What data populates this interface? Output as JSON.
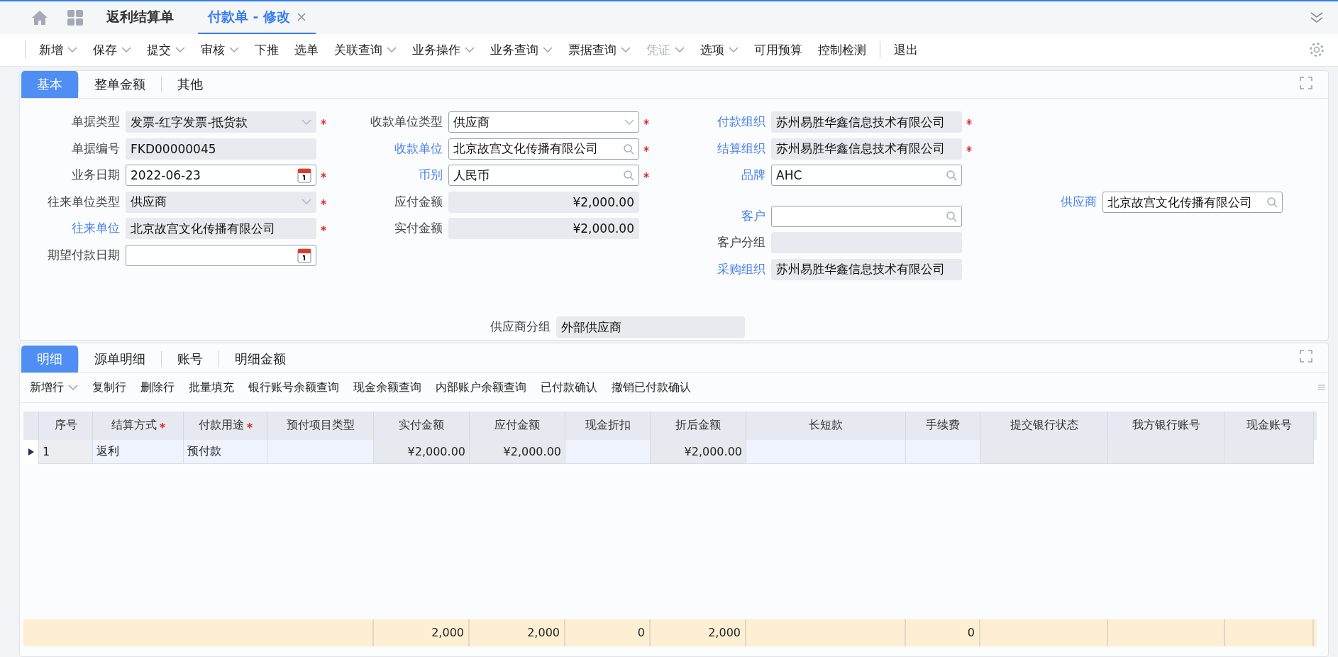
{
  "top_tabs": [
    {
      "label": "返利结算单",
      "selected": false,
      "closable": false
    },
    {
      "label": "付款单 - 修改",
      "selected": true,
      "closable": true
    }
  ],
  "toolbar": {
    "groups": [
      [
        {
          "label": "新增",
          "dropdown": true,
          "disabled": false
        },
        {
          "label": "保存",
          "dropdown": true,
          "disabled": false
        },
        {
          "label": "提交",
          "dropdown": true,
          "disabled": false
        },
        {
          "label": "审核",
          "dropdown": true,
          "disabled": false
        },
        {
          "label": "下推",
          "dropdown": false,
          "disabled": false
        },
        {
          "label": "选单",
          "dropdown": false,
          "disabled": false
        },
        {
          "label": "关联查询",
          "dropdown": true,
          "disabled": false
        },
        {
          "label": "业务操作",
          "dropdown": true,
          "disabled": false
        },
        {
          "label": "业务查询",
          "dropdown": true,
          "disabled": false
        },
        {
          "label": "票据查询",
          "dropdown": true,
          "disabled": false
        },
        {
          "label": "凭证",
          "dropdown": true,
          "disabled": true
        },
        {
          "label": "选项",
          "dropdown": true,
          "disabled": false
        },
        {
          "label": "可用预算",
          "dropdown": false,
          "disabled": false
        },
        {
          "label": "控制检测",
          "dropdown": false,
          "disabled": false
        }
      ],
      [
        {
          "label": "退出",
          "dropdown": false,
          "disabled": false
        }
      ]
    ]
  },
  "header_tabs": [
    {
      "label": "基本",
      "selected": true
    },
    {
      "label": "整单金额",
      "selected": false
    },
    {
      "label": "其他",
      "selected": false
    }
  ],
  "form": {
    "columns": [
      [
        {
          "label": "单据类型",
          "kind": "select",
          "value": "发票-红字发票-抵货款",
          "readonly": true,
          "link": false,
          "required": true
        },
        {
          "label": "单据编号",
          "value": "FKD00000045",
          "readonly": true,
          "link": false,
          "required": false
        },
        {
          "label": "业务日期",
          "kind": "date",
          "value": "2022-06-23",
          "readonly": false,
          "link": false,
          "required": true
        },
        {
          "label": "往来单位类型",
          "kind": "select",
          "value": "供应商",
          "readonly": true,
          "link": false,
          "required": true
        },
        {
          "label": "往来单位",
          "value": "北京故宫文化传播有限公司",
          "readonly": true,
          "link": true,
          "required": true
        },
        {
          "label": "期望付款日期",
          "kind": "date",
          "readonly": false,
          "link": false,
          "required": false
        }
      ],
      [
        {
          "label": "收款单位类型",
          "kind": "select",
          "value": "供应商",
          "readonly": false,
          "link": false,
          "required": true
        },
        {
          "label": "收款单位",
          "kind": "lookup",
          "value": "北京故宫文化传播有限公司",
          "readonly": false,
          "link": true,
          "required": true
        },
        {
          "label": "币别",
          "kind": "lookup",
          "value": "人民币",
          "readonly": false,
          "link": true,
          "required": true
        },
        {
          "label": "应付金额",
          "kind": "amount",
          "value": "¥2,000.00",
          "readonly": true,
          "link": false,
          "required": false
        },
        {
          "label": "实付金额",
          "kind": "amount",
          "value": "¥2,000.00",
          "readonly": true,
          "link": false,
          "required": false
        }
      ],
      [
        {
          "label": "付款组织",
          "value": "苏州易胜华鑫信息技术有限公司",
          "readonly": true,
          "link": true,
          "required": true
        },
        {
          "label": "结算组织",
          "value": "苏州易胜华鑫信息技术有限公司",
          "readonly": true,
          "link": true,
          "required": true
        },
        {
          "label": "品牌",
          "kind": "lookup",
          "value": "AHC",
          "readonly": false,
          "link": true,
          "required": false
        },
        {
          "label": "客户",
          "kind": "lookup",
          "readonly": false,
          "link": true,
          "required": false
        },
        {
          "label": "客户分组",
          "readonly": true,
          "link": false,
          "required": false
        },
        {
          "label": "采购组织",
          "value": "苏州易胜华鑫信息技术有限公司",
          "readonly": true,
          "link": true,
          "required": false
        }
      ],
      [
        {
          "label": "供应商",
          "kind": "lookup",
          "value": "北京故宫文化传播有限公司",
          "readonly": false,
          "link": true,
          "required": false
        }
      ]
    ],
    "bottom": {
      "label": "供应商分组",
      "value": "外部供应商",
      "readonly": true,
      "link": false,
      "required": false
    }
  },
  "detail_tabs": [
    {
      "label": "明细",
      "selected": true
    },
    {
      "label": "源单明细",
      "selected": false
    },
    {
      "label": "账号",
      "selected": false
    },
    {
      "label": "明细金额",
      "selected": false
    }
  ],
  "detail_toolbar": [
    {
      "label": "新增行",
      "dropdown": true
    },
    {
      "label": "复制行",
      "dropdown": false
    },
    {
      "label": "删除行",
      "dropdown": false
    },
    {
      "label": "批量填充",
      "dropdown": false
    },
    {
      "label": "银行账号余额查询",
      "dropdown": false
    },
    {
      "label": "现金余额查询",
      "dropdown": false
    },
    {
      "label": "内部账户余额查询",
      "dropdown": false
    },
    {
      "label": "已付款确认",
      "dropdown": false
    },
    {
      "label": "撤销已付款确认",
      "dropdown": false
    }
  ],
  "table": {
    "columns": [
      {
        "label": "序号",
        "kind": "index",
        "required": false
      },
      {
        "label": "结算方式",
        "editable": true,
        "required": true
      },
      {
        "label": "付款用途",
        "editable": true,
        "required": true
      },
      {
        "label": "预付项目类型",
        "editable": true,
        "required": false
      },
      {
        "label": "实付金额",
        "kind": "amount",
        "editable": false,
        "required": false,
        "total": "2,000"
      },
      {
        "label": "应付金额",
        "kind": "amount",
        "editable": false,
        "required": false,
        "total": "2,000"
      },
      {
        "label": "现金折扣",
        "kind": "amount",
        "editable": true,
        "required": false,
        "total": "0"
      },
      {
        "label": "折后金额",
        "kind": "amount",
        "editable": false,
        "required": false,
        "total": "2,000"
      },
      {
        "label": "长短款",
        "kind": "amount",
        "editable": true,
        "required": false
      },
      {
        "label": "手续费",
        "kind": "amount",
        "editable": true,
        "required": false,
        "total": "0"
      },
      {
        "label": "提交银行状态",
        "editable": false,
        "required": false
      },
      {
        "label": "我方银行账号",
        "editable": false,
        "required": false
      },
      {
        "label": "现金账号",
        "editable": false,
        "required": false
      }
    ],
    "rows": [
      {
        "selected": true,
        "cells": [
          "1",
          "返利",
          "预付款",
          null,
          "¥2,000.00",
          "¥2,000.00",
          null,
          "¥2,000.00",
          null,
          null,
          null,
          null,
          null
        ]
      }
    ]
  }
}
